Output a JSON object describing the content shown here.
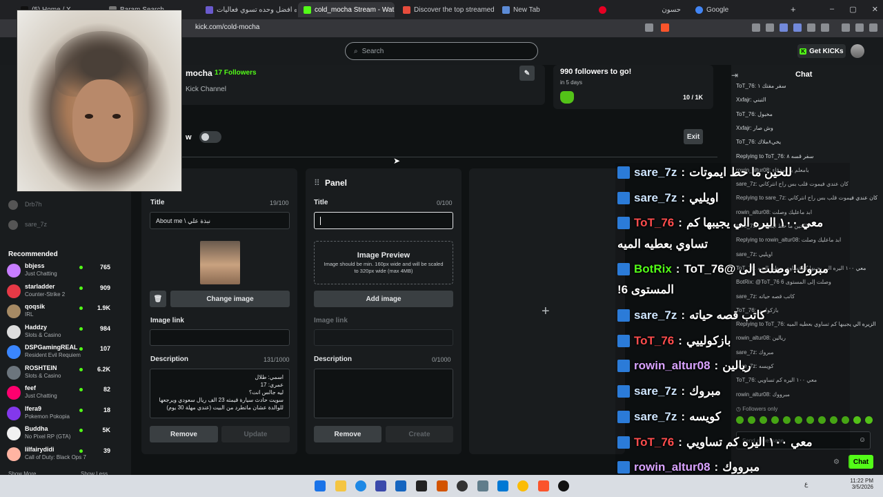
{
  "browser": {
    "tabs": [
      {
        "label": "(5) Home / X"
      },
      {
        "label": "Baram Search"
      },
      {
        "label": "شاره افضل وحده تسوي فعاليات"
      },
      {
        "label": "cold_mocha Stream - Wat"
      },
      {
        "label": "Discover the top streamed mu"
      },
      {
        "label": "New Tab"
      },
      {
        "label": "حسون"
      },
      {
        "label": "Google"
      }
    ],
    "url": "kick.com/cold-mocha"
  },
  "header": {
    "search_placeholder": "Search",
    "get_kicks": "Get KICKs"
  },
  "channel": {
    "name": "mocha",
    "followers": "17 Followers",
    "sub": "Kick Channel"
  },
  "goal": {
    "title": "990 followers to go!",
    "sub": "in 5 days",
    "progress": "10 / 1K",
    "fraction": 0.01
  },
  "editbar": {
    "label": "w",
    "exit": "Exit"
  },
  "panel1": {
    "title_label": "Title",
    "title_count": "19/100",
    "title_value": "About me \\ نبذة علي",
    "change_image": "Change image",
    "image_link_label": "Image link",
    "description_label": "Description",
    "description_count": "131/1000",
    "description_lines": [
      "اسمي: طلال",
      "عمري: 17",
      "ليه جالس انت؟",
      "سويت حادث سيارة قيمته 23 الف ريال سعودي ويرجعها",
      "للوالدة عشان ماتطرد من البيت (عندي مهلة 30 يوم)"
    ],
    "remove": "Remove",
    "update": "Update"
  },
  "panel2": {
    "header": "Panel",
    "title_label": "Title",
    "title_count": "0/100",
    "preview_title": "Image Preview",
    "preview_text": "Image should be min. 160px wide and will be scaled to 320px wide (max 4MB)",
    "add_image": "Add image",
    "image_link_label": "Image link",
    "description_label": "Description",
    "description_count": "0/1000",
    "remove": "Remove",
    "create": "Create"
  },
  "sidebar": {
    "following": [
      {
        "name": "Drb7h"
      },
      {
        "name": "sare_7z"
      }
    ],
    "recommended_title": "Recommended",
    "recommended": [
      {
        "name": "bbjess",
        "category": "Just Chatting",
        "viewers": "765",
        "color": "#c77dff"
      },
      {
        "name": "starladder",
        "category": "Counter-Strike 2",
        "viewers": "909",
        "color": "#e63946"
      },
      {
        "name": "qoqsik",
        "category": "IRL",
        "viewers": "1.9K",
        "color": "#a68a64"
      },
      {
        "name": "Haddzy",
        "category": "Slots & Casino",
        "viewers": "984",
        "color": "#ddd"
      },
      {
        "name": "DSPGamingREAL",
        "category": "Resident Evil Requiem",
        "viewers": "107",
        "color": "#3a86ff"
      },
      {
        "name": "ROSHTEIN",
        "category": "Slots & Casino",
        "viewers": "6.2K",
        "color": "#6c757d"
      },
      {
        "name": "feef",
        "category": "Just Chatting",
        "viewers": "82",
        "color": "#ff006e"
      },
      {
        "name": "lfera9",
        "category": "Pokemon Pokopia",
        "viewers": "18",
        "color": "#8338ec"
      },
      {
        "name": "Buddha",
        "category": "No Pixel RP (GTA)",
        "viewers": "5K",
        "color": "#f1f1f1"
      },
      {
        "name": "lilfairydidi",
        "category": "Call of Duty: Black Ops 7",
        "viewers": "39",
        "color": "#ffb4a2"
      }
    ],
    "show_more": "Show More",
    "show_less": "Show Less"
  },
  "chat": {
    "title": "Chat",
    "lines": [
      "ToT_76: سفر مفتك ١",
      "Xxfajr: التبني",
      "ToT_76: مخبول",
      "Xxfajr: وش صار",
      "ToT_76: يخي٨ملاك",
      "Replying to ToT_76: سفر قسه ٨",
      "rowin_altur08: بامعلم يا اصدقاء",
      "sare_7z: كان عندي فيموت قلب بس راح انتركاني",
      "Replying to sare_7z: كان عندي فيموت قلب بس راح انتركاني",
      "rowin_altur08: ابد ماعليك وصلت",
      "sare_7z: للحين ما حط ايموتات",
      "Replying to rowin_altur08: ابد ماعليك وصلت",
      "sare_7z: اويليي",
      "ToT_76: معي ١٠٠ اليره الي يجيبها كم تساوي بعطيه الميه",
      "BotRix: @ToT_76 وصلت إلى المستوى 6",
      "sare_7z: كاتب قصه حياته",
      "ToT_76: بازكولييي",
      "Replying to ToT_76: الزيره الي يجيبها كم تساوي بعطيه الميه",
      "rowin_altur08: ريالين",
      "sare_7z: مبروك",
      "sare_7z: كويسه",
      "ToT_76: معي ١٠٠ اليره كم تساويي",
      "rowin_altur08: مبرووك"
    ],
    "followers_only": "Followers only",
    "send_label": "Send a message",
    "chat_button": "Chat"
  },
  "overlay": [
    {
      "user": "sare_7z",
      "text": "للحين ما حط ايموتات"
    },
    {
      "user": "sare_7z",
      "text": "اويليي"
    },
    {
      "user": "ToT_76",
      "text": "معي ١٠٠ اليره الي يجيبها كم"
    },
    {
      "user": "",
      "text": "تساوي بعطيه الميه"
    },
    {
      "user": "BotRix",
      "text": "مبروك! وصلت إلى @ToT_76"
    },
    {
      "user": "",
      "text": "المستوى 6!"
    },
    {
      "user": "sare_7z",
      "text": "كاتب قصه حياته"
    },
    {
      "user": "ToT_76",
      "text": "بازكولييي"
    },
    {
      "user": "rowin_altur08",
      "text": "ريالين"
    },
    {
      "user": "sare_7z",
      "text": "مبروك"
    },
    {
      "user": "sare_7z",
      "text": "كويسه"
    },
    {
      "user": "ToT_76",
      "text": "معي ١٠٠ اليره كم تساويي"
    },
    {
      "user": "rowin_altur08",
      "text": "مبرووك"
    }
  ],
  "taskbar": {
    "time": "11:22 PM",
    "date": "3/5/2026",
    "lang": "ع"
  }
}
